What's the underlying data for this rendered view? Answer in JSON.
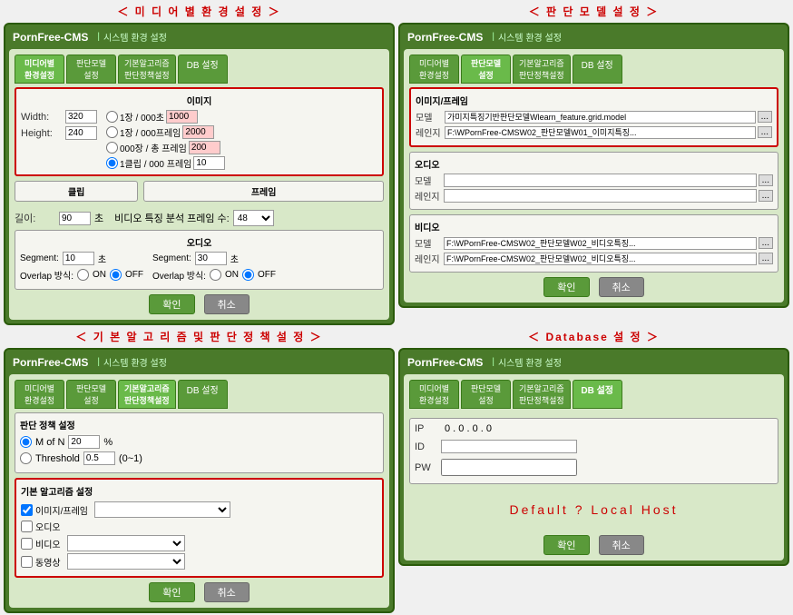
{
  "topLeftLabel": "＜ 미 디 어 별  환 경 설 정 ＞",
  "topRightLabel": "＜ 판 단 모 델  설 정 ＞",
  "bottomLeftLabel": "＜ 기 본 알 고 리 즘  및  판 단 정 책 설 정 ＞",
  "bottomRightLabel": "＜ Database 설 정 ＞",
  "appTitle": "PornFree-CMS",
  "systemSetting": "시스템 환경 설정",
  "tabs": {
    "media": "미디어별\n환경설정",
    "model": "판단모델\n설정",
    "algorithm": "기본알고리즘\n판단정책설정",
    "db": "DB 설정"
  },
  "panel1": {
    "imageSection": "이미지",
    "width_label": "Width:",
    "width_value": "320",
    "height_label": "Height:",
    "height_value": "240",
    "radio1": "1장 / 000초",
    "radio2": "1장 / 000프레임",
    "radio3": "000장 / 총 프레임",
    "radio4_selected": "1클립 / 000 프레임",
    "radio4_value": "10",
    "input_1000": "1000",
    "input_2000": "2000",
    "input_200": "200",
    "clipSection": "클립",
    "frameSection": "프레임",
    "length_label": "길이:",
    "length_value": "90",
    "length_unit": "초",
    "analysis_label": "비디오 특징 분석 프레임 수:",
    "analysis_value": "48",
    "audioSection": "오디오",
    "segment_label": "Segment:",
    "segment_value1": "10",
    "segment_unit1": "초",
    "segment_value2": "30",
    "segment_unit2": "초",
    "overlap_label": "Overlap 방식:",
    "overlap_on": "ON",
    "overlap_off1": "OFF",
    "overlap_on2": "ON",
    "overlap_off2": "OFF",
    "confirm": "확인",
    "cancel": "취소"
  },
  "panel2": {
    "imageFrameSection": "이미지/프레임",
    "model_label": "모델",
    "range_label": "레인지",
    "model_value": "가미지특징기반판단모델Wlearn_feature.grid.model",
    "range_value": "F:\\WPornFree-CMSW02_판단모델W01_이미지특징...",
    "audioSection": "오디오",
    "audio_model_label": "모델",
    "audio_range_label": "레인지",
    "audio_model_value": "",
    "audio_range_value": "",
    "videoSection": "비디오",
    "video_model_label": "모델",
    "video_range_label": "레인지",
    "video_model_value": "F:\\WPornFree-CMSW02_판단모델W02_비디오특징...",
    "video_range_value": "F:\\WPornFree-CMSW02_판단모델W02_비디오특징...",
    "confirm": "확인",
    "cancel": "취소"
  },
  "panel3": {
    "policySection": "판단 정책 설정",
    "mofn_label": "M of N",
    "mofn_value": "20",
    "mofn_percent": "%",
    "threshold_label": "Threshold",
    "threshold_value": "0.5",
    "threshold_range": "(0~1)",
    "algorithmSection": "기본 알고리즘 설정",
    "image_frame_label": "이미지/프레임",
    "audio_label": "오디오",
    "video_label": "비디오",
    "animation_label": "동영상",
    "confirm": "확인",
    "cancel": "취소"
  },
  "panel4": {
    "ip_label": "IP",
    "ip_dots": "0 . 0 . 0 . 0",
    "id_label": "ID",
    "pw_label": "PW",
    "default_text": "Default ? Local Host",
    "confirm": "확인",
    "cancel": "취소"
  }
}
